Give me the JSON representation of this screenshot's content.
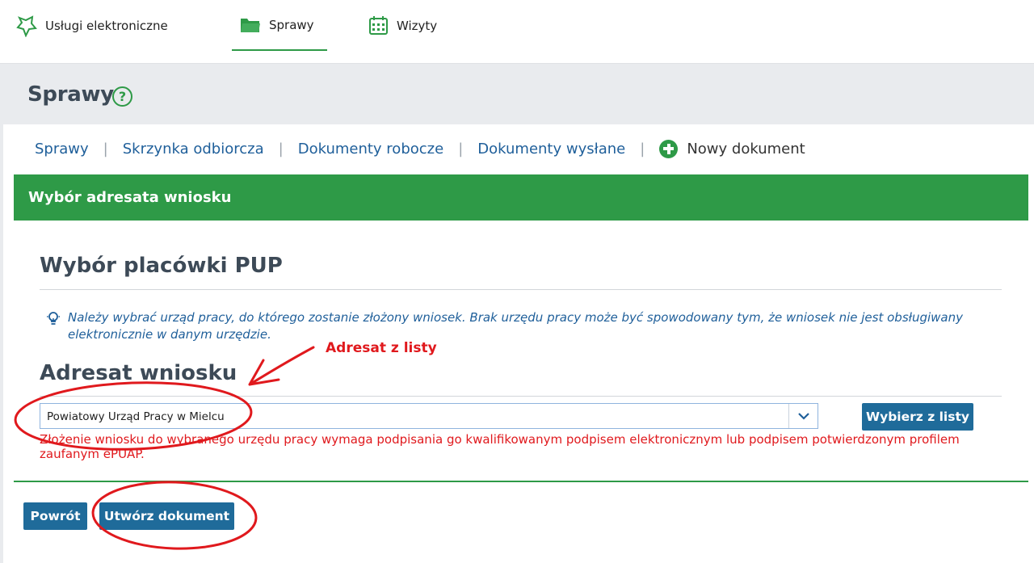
{
  "topnav": {
    "items": [
      {
        "label": "Usługi elektroniczne",
        "icon": "services-star-icon"
      },
      {
        "label": "Sprawy",
        "icon": "folder-icon",
        "active": true
      },
      {
        "label": "Wizyty",
        "icon": "calendar-icon"
      }
    ]
  },
  "page": {
    "title": "Sprawy",
    "help": "?"
  },
  "subnav": {
    "items": [
      "Sprawy",
      "Skrzynka odbiorcza",
      "Dokumenty robocze",
      "Dokumenty wysłane"
    ],
    "separator": "|",
    "new_document": "Nowy dokument"
  },
  "panel": {
    "header": "Wybór adresata wniosku"
  },
  "form": {
    "section_title": "Wybór placówki PUP",
    "info_text": "Należy wybrać urząd pracy, do którego zostanie złożony wniosek. Brak urzędu pracy może być spowodowany tym, że wniosek nie jest obsługiwany elektronicznie w danym urzędzie.",
    "recipient_title": "Adresat wniosku",
    "recipient_value": "Powiatowy Urząd Pracy w Mielcu",
    "pick_from_list": "Wybierz z listy",
    "error": "Złożenie wniosku do wybranego urzędu pracy wymaga podpisania go kwalifikowanym podpisem elektronicznym lub podpisem potwierdzonym profilem zaufanym ePUAP."
  },
  "actions": {
    "back": "Powrót",
    "create": "Utwórz dokument"
  },
  "annotation": {
    "label": "Adresat z listy"
  },
  "colors": {
    "green": "#2e9a47",
    "button_blue": "#1f6b9a",
    "link_blue": "#1f5f9a",
    "error_red": "#e0191d"
  }
}
